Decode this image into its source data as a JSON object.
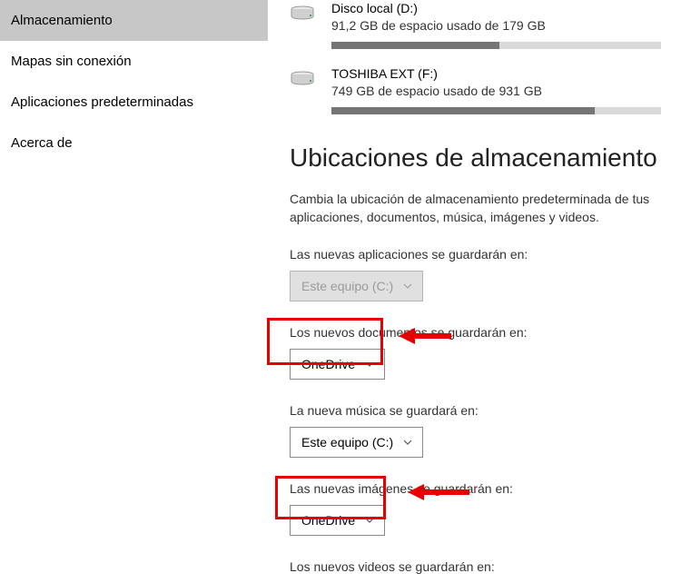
{
  "sidebar": {
    "items": [
      {
        "label": "Almacenamiento"
      },
      {
        "label": "Mapas sin conexión"
      },
      {
        "label": "Aplicaciones predeterminadas"
      },
      {
        "label": "Acerca de"
      }
    ]
  },
  "drives": [
    {
      "name": "Disco local (D:)",
      "usage_text": "91,2 GB de espacio usado de 179 GB",
      "used_pct": 51
    },
    {
      "name": "TOSHIBA EXT (F:)",
      "usage_text": "749 GB de espacio usado de 931 GB",
      "used_pct": 80
    }
  ],
  "storage": {
    "title": "Ubicaciones de almacenamiento",
    "description": "Cambia la ubicación de almacenamiento predeterminada de tus aplicaciones, documentos, música, imágenes y videos.",
    "apps": {
      "label": "Las nuevas aplicaciones se guardarán en:",
      "value": "Este equipo (C:)"
    },
    "docs": {
      "label": "Los nuevos documentos se guardarán en:",
      "value": "OneDrive"
    },
    "music": {
      "label": "La nueva música se guardará en:",
      "value": "Este equipo (C:)"
    },
    "images": {
      "label": "Las nuevas imágenes se guardarán en:",
      "value": "OneDrive"
    },
    "videos_label": "Los nuevos videos se guardarán en:"
  }
}
